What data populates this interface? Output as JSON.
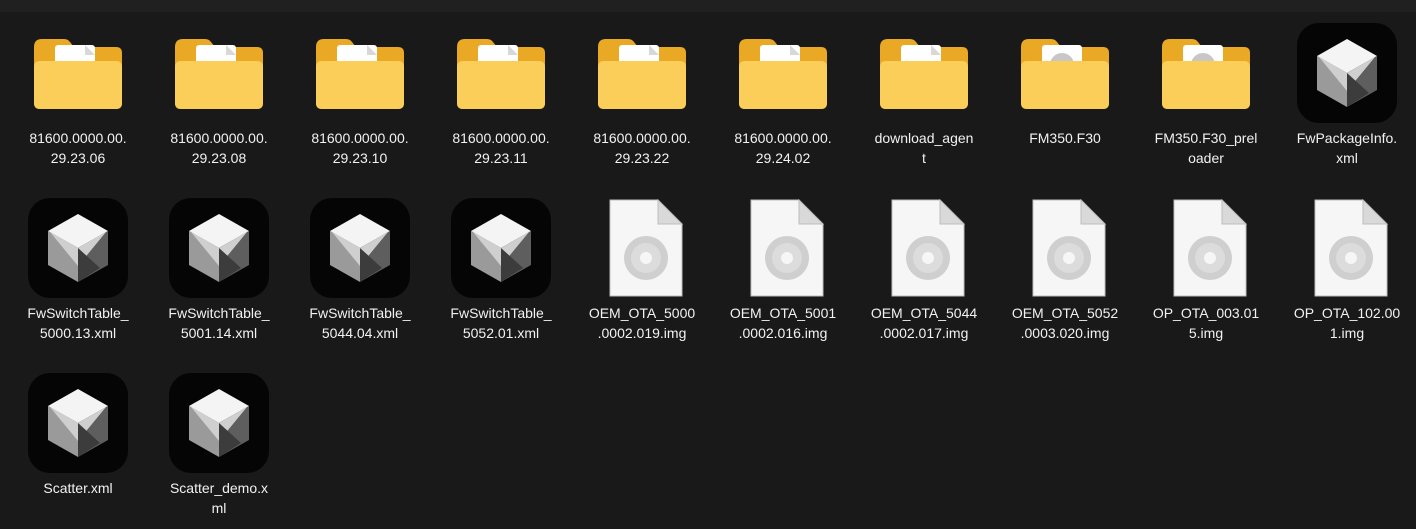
{
  "colors": {
    "background": "#191919",
    "label_text": "#f2f2f2",
    "folder_back": "#e9a925",
    "folder_front": "#fbcd59",
    "app_icon_bg": "#050505"
  },
  "files": [
    {
      "name": "81600.0000.00.\n29.23.06",
      "icon": "folder-icon"
    },
    {
      "name": "81600.0000.00.\n29.23.08",
      "icon": "folder-icon"
    },
    {
      "name": "81600.0000.00.\n29.23.10",
      "icon": "folder-icon"
    },
    {
      "name": "81600.0000.00.\n29.23.11",
      "icon": "folder-icon"
    },
    {
      "name": "81600.0000.00.\n29.23.22",
      "icon": "folder-icon"
    },
    {
      "name": "81600.0000.00.\n29.24.02",
      "icon": "folder-icon"
    },
    {
      "name": "download_agen\nt",
      "icon": "folder-icon"
    },
    {
      "name": "FM350.F30",
      "icon": "folder-disc-icon"
    },
    {
      "name": "FM350.F30_prel\noader",
      "icon": "folder-disc-icon"
    },
    {
      "name": "FwPackageInfo.\nxml",
      "icon": "xml-app-icon"
    },
    {
      "name": "FwSwitchTable_\n5000.13.xml",
      "icon": "xml-app-icon"
    },
    {
      "name": "FwSwitchTable_\n5001.14.xml",
      "icon": "xml-app-icon"
    },
    {
      "name": "FwSwitchTable_\n5044.04.xml",
      "icon": "xml-app-icon"
    },
    {
      "name": "FwSwitchTable_\n5052.01.xml",
      "icon": "xml-app-icon"
    },
    {
      "name": "OEM_OTA_5000\n.0002.019.img",
      "icon": "disc-image-icon"
    },
    {
      "name": "OEM_OTA_5001\n.0002.016.img",
      "icon": "disc-image-icon"
    },
    {
      "name": "OEM_OTA_5044\n.0002.017.img",
      "icon": "disc-image-icon"
    },
    {
      "name": "OEM_OTA_5052\n.0003.020.img",
      "icon": "disc-image-icon"
    },
    {
      "name": "OP_OTA_003.01\n5.img",
      "icon": "disc-image-icon"
    },
    {
      "name": "OP_OTA_102.00\n1.img",
      "icon": "disc-image-icon"
    },
    {
      "name": "Scatter.xml",
      "icon": "xml-app-icon"
    },
    {
      "name": "Scatter_demo.x\nml",
      "icon": "xml-app-icon"
    }
  ]
}
